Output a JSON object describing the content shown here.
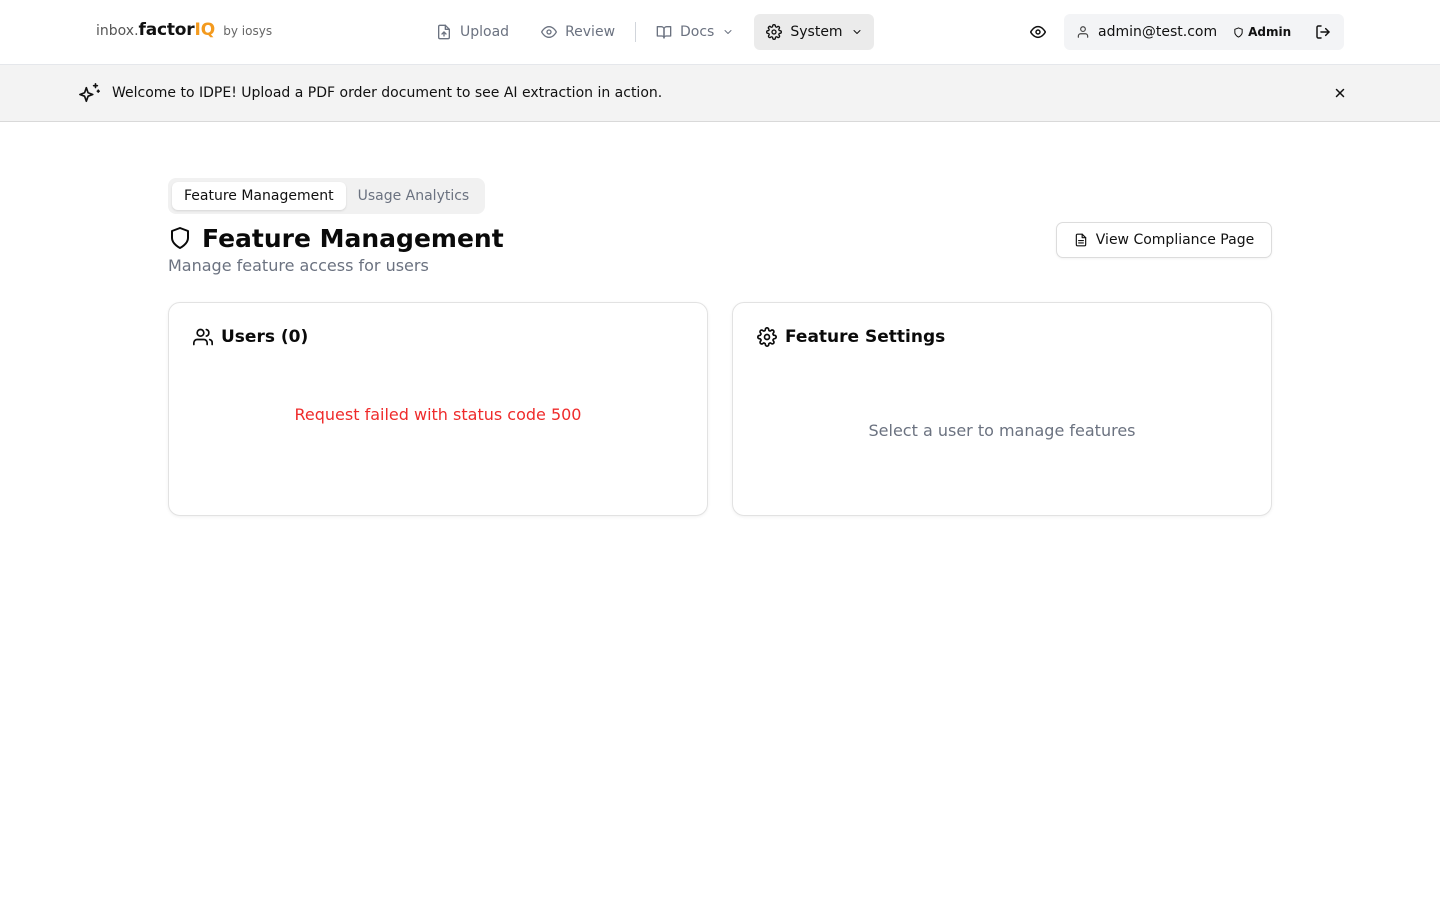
{
  "brand": {
    "prefix": "inbox.",
    "name": "factor",
    "accent": "IQ",
    "by": "by iosys",
    "accent_color": "#f39a1e"
  },
  "nav": {
    "upload": "Upload",
    "review": "Review",
    "docs": "Docs",
    "system": "System"
  },
  "user": {
    "email": "admin@test.com",
    "role": "Admin"
  },
  "banner": {
    "text": "Welcome to IDPE! Upload a PDF order document to see AI extraction in action."
  },
  "tabs": {
    "feature_management": "Feature Management",
    "usage_analytics": "Usage Analytics",
    "active": "feature_management"
  },
  "page": {
    "title": "Feature Management",
    "subtitle": "Manage feature access for users",
    "compliance_button": "View Compliance Page"
  },
  "users_card": {
    "title": "Users (0)",
    "error": "Request failed with status code 500",
    "error_color": "#ef2b2b"
  },
  "settings_card": {
    "title": "Feature Settings",
    "empty": "Select a user to manage features"
  },
  "icons": {
    "upload": "file-upload-icon",
    "review": "eye-icon",
    "docs": "book-open-icon",
    "system": "gear-icon",
    "dropdown": "chevron-down-icon",
    "preview": "eye-icon",
    "user": "user-icon",
    "role": "shield-icon",
    "logout": "logout-icon",
    "banner": "sparkles-icon",
    "close": "close-icon",
    "title": "shield-icon",
    "compliance": "file-text-icon",
    "users": "users-icon",
    "settings": "gear-icon"
  }
}
